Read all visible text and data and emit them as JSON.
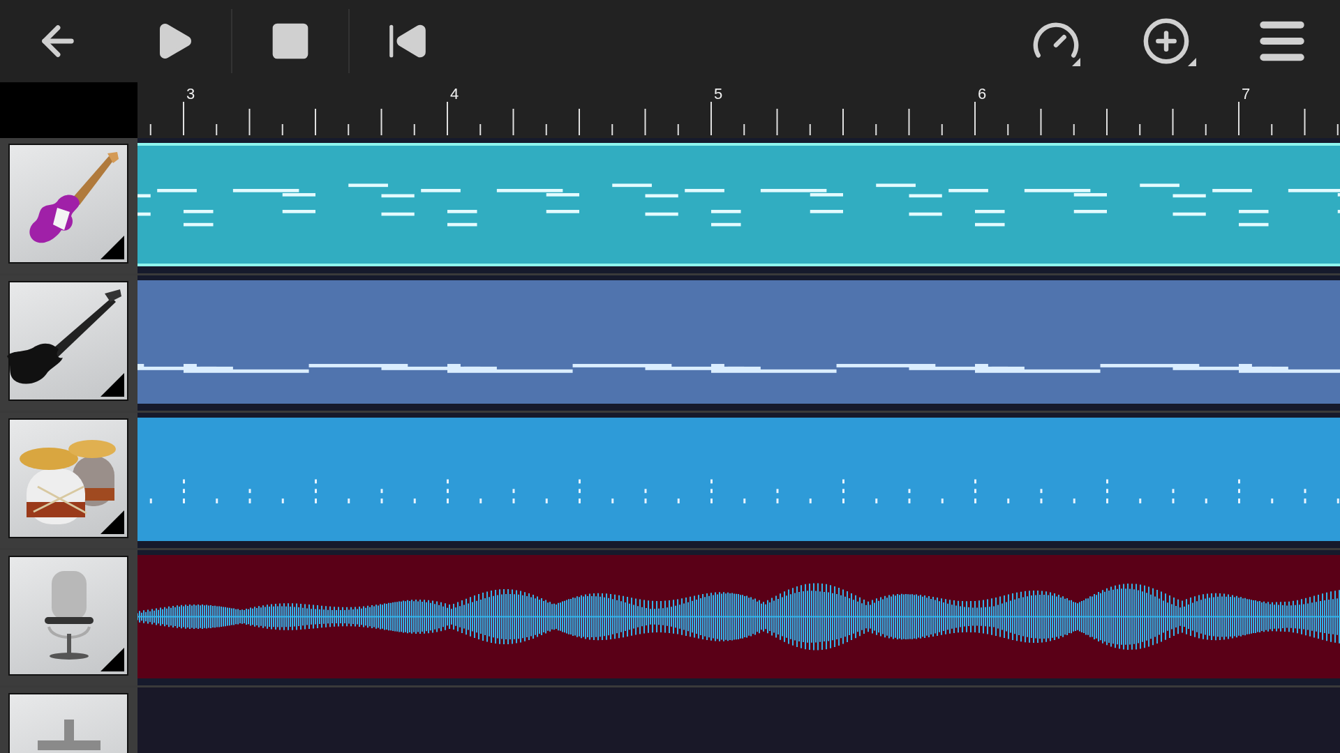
{
  "ruler": {
    "bars": [
      "3",
      "4",
      "5",
      "6",
      "7"
    ]
  },
  "tracks": [
    {
      "kind": "guitar",
      "color": "#31adc1",
      "selected": true
    },
    {
      "kind": "bass",
      "color": "#5074ae",
      "selected": false
    },
    {
      "kind": "drums",
      "color": "#2e9bd8",
      "selected": false
    },
    {
      "kind": "microphone",
      "color": "#5a0017",
      "selected": false
    }
  ]
}
